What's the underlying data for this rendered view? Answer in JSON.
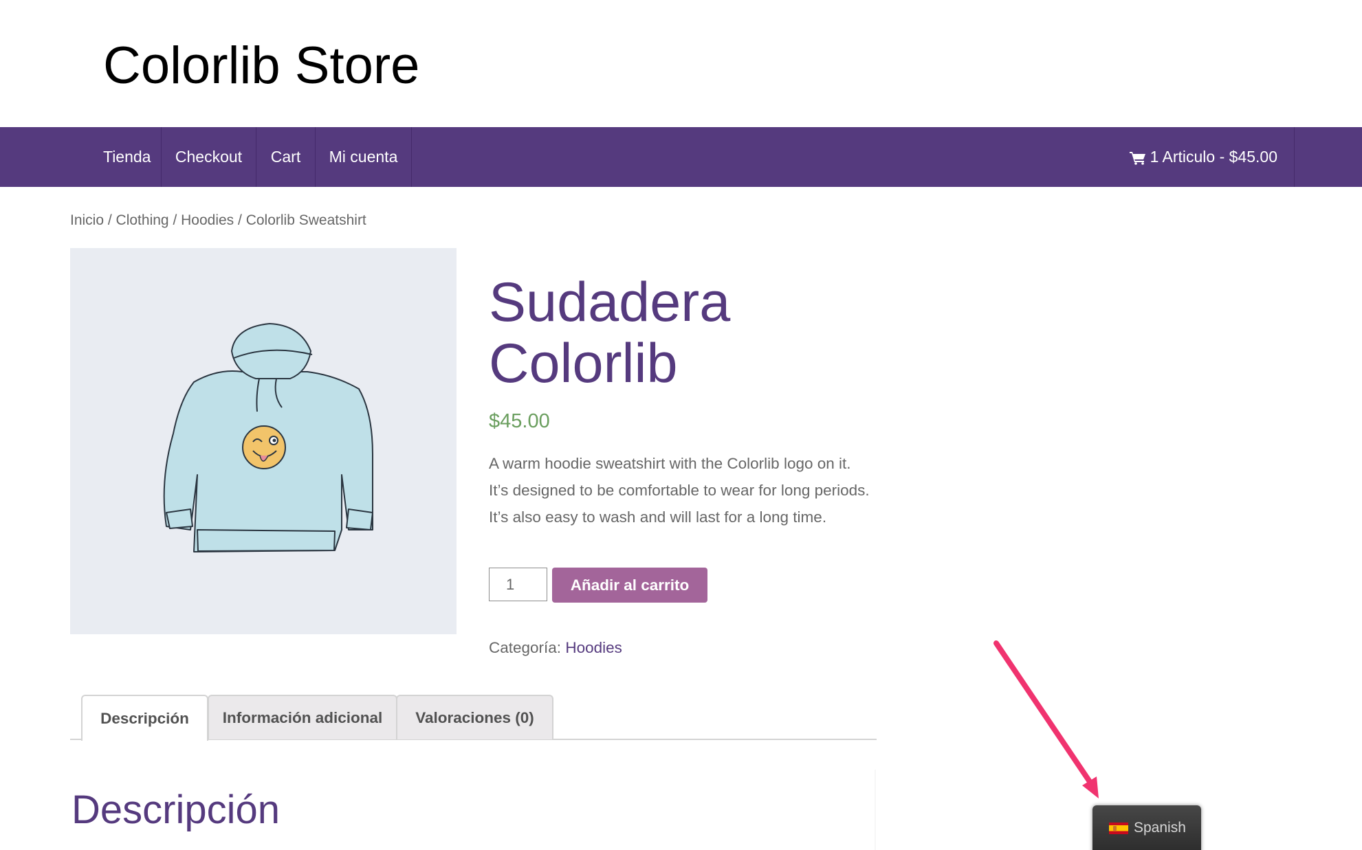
{
  "site": {
    "title": "Colorlib Store"
  },
  "nav": {
    "items": [
      {
        "label": "Tienda"
      },
      {
        "label": "Checkout"
      },
      {
        "label": "Cart"
      },
      {
        "label": "Mi cuenta"
      }
    ],
    "cart": {
      "icon": "shopping-cart-icon",
      "label": "1 Articulo - $45.00",
      "count": 1,
      "total": "$45.00"
    }
  },
  "breadcrumb": {
    "items": [
      "Inicio",
      "Clothing",
      "Hoodies",
      "Colorlib Sweatshirt"
    ],
    "separator": " / "
  },
  "product": {
    "image_alt": "Light blue hoodie with winking emoji",
    "title": "Sudadera Colorlib",
    "price": "$45.00",
    "description": "A warm hoodie sweatshirt with the Colorlib logo on it. It’s designed to be comfortable to wear for long periods. It’s also easy to wash and will last for a long time.",
    "quantity": "1",
    "add_to_cart_label": "Añadir al carrito",
    "category_label": "Categoría:",
    "category_value": "Hoodies"
  },
  "tabs": [
    {
      "label": "Descripción",
      "active": true
    },
    {
      "label": "Información adicional",
      "active": false
    },
    {
      "label": "Valoraciones (0)",
      "active": false
    }
  ],
  "panel": {
    "title": "Descripción"
  },
  "language_switcher": {
    "label": "Spanish",
    "flag": "spain-flag-icon"
  },
  "colors": {
    "nav_bg": "#553a7e",
    "title_purple": "#553a7e",
    "price_green": "#6a9e5e",
    "button_bg": "#a3659a",
    "annotation_arrow": "#f0336f"
  }
}
